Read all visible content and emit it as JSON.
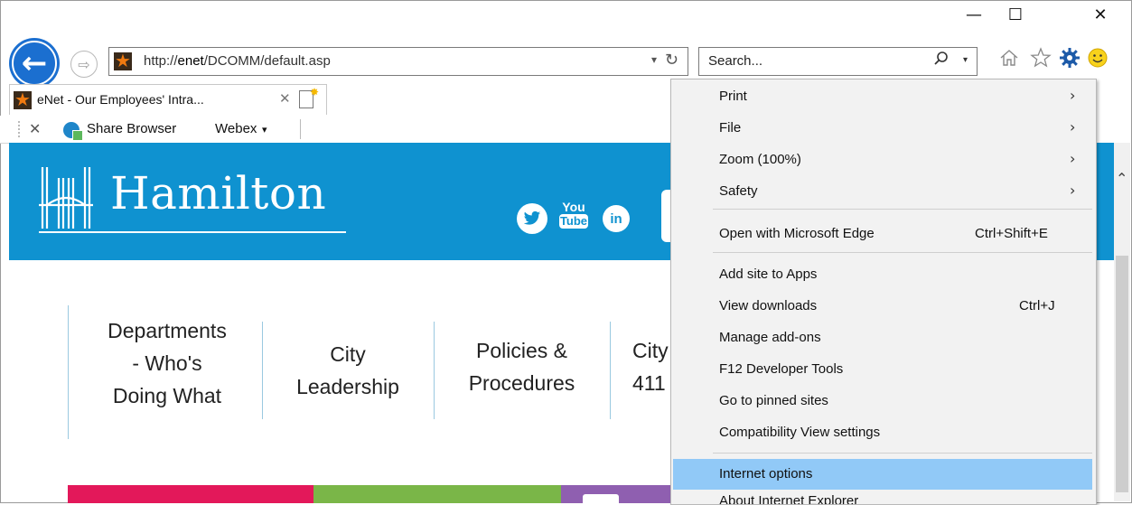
{
  "window": {
    "minimize": "—",
    "maximize": "☐",
    "close": "✕"
  },
  "address_bar": {
    "url_prefix": "http://",
    "url_host": "enet",
    "url_path": "/DCOMM/default.asp",
    "dropdown": "▾",
    "refresh": "↻"
  },
  "search_bar": {
    "placeholder": "Search...",
    "icon": "⚲",
    "dropdown": "▾"
  },
  "toolbar_icons": {
    "home": "⌂",
    "favorites": "☆",
    "tools": "⚙",
    "feedback": "☺"
  },
  "tab": {
    "title": "eNet - Our Employees' Intra...",
    "close": "✕"
  },
  "links_bar": {
    "close": "✕",
    "share": "Share Browser",
    "webex": "Webex",
    "webex_dropdown": "▾"
  },
  "page": {
    "logo_text": "Hamilton",
    "social": {
      "twitter": "t",
      "youtube_top": "You",
      "youtube_bottom": "Tube",
      "linkedin": "in"
    },
    "nav": [
      {
        "line1": "Departments",
        "line2": "- Who's",
        "line3": "Doing What"
      },
      {
        "line1": "City",
        "line2": "Leadership"
      },
      {
        "line1": "Policies &",
        "line2": "Procedures"
      },
      {
        "line1": "City",
        "line2": "411"
      }
    ],
    "tile_colors": [
      "#e3185a",
      "#7ab648",
      "#8f5fb0"
    ]
  },
  "menu": {
    "items": [
      {
        "label": "Print",
        "arrow": "›"
      },
      {
        "label": "File",
        "arrow": "›"
      },
      {
        "label": "Zoom (100%)",
        "arrow": "›"
      },
      {
        "label": "Safety",
        "arrow": "›"
      },
      {
        "label": "Open with Microsoft Edge",
        "shortcut": "Ctrl+Shift+E"
      },
      {
        "label": "Add site to Apps"
      },
      {
        "label": "View downloads",
        "shortcut": "Ctrl+J"
      },
      {
        "label": "Manage add-ons"
      },
      {
        "label": "F12 Developer Tools"
      },
      {
        "label": "Go to pinned sites"
      },
      {
        "label": "Compatibility View settings"
      },
      {
        "label": "Internet options"
      },
      {
        "label": "About Internet Explorer"
      }
    ],
    "highlight_color": "#91c9f7"
  },
  "colors": {
    "ie_blue": "#1b6fd0",
    "hamilton_blue": "#0f92d0"
  }
}
